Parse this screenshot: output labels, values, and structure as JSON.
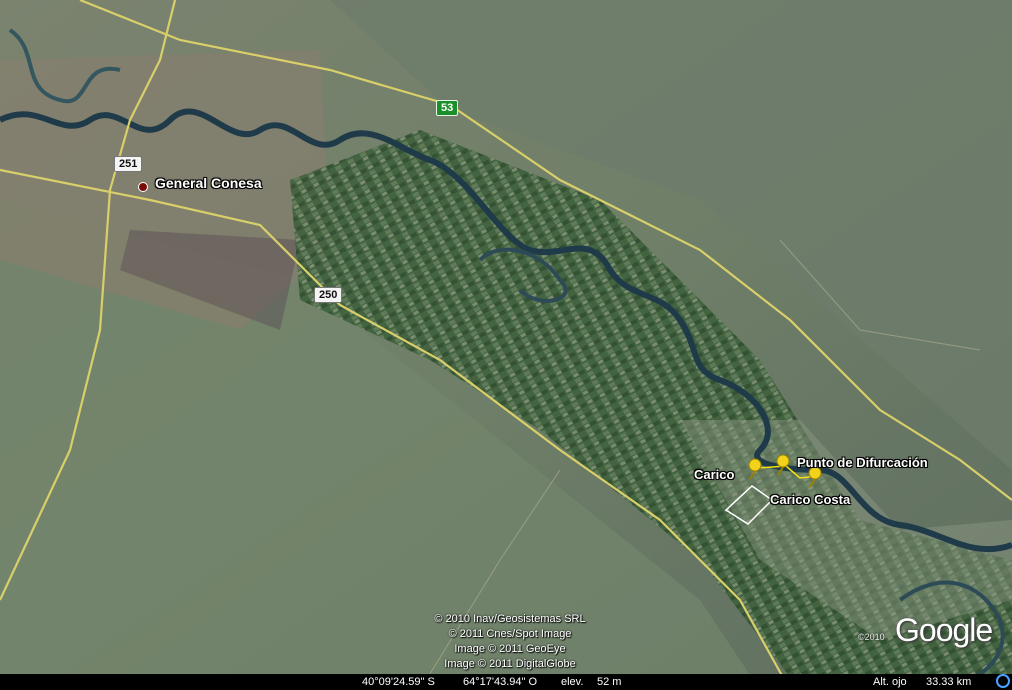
{
  "places": {
    "town": "General Conesa",
    "pin_carico": "Carico",
    "pin_carico_costa": "Carico Costa",
    "pin_difurcacion": "Punto de Difurcación"
  },
  "routes": {
    "r251": "251",
    "r250": "250",
    "r53": "53"
  },
  "copyright": [
    "© 2010 Inav/Geosistemas SRL",
    "© 2011 Cnes/Spot Image",
    "Image © 2011 GeoEye",
    "Image © 2011 DigitalGlobe"
  ],
  "logo": {
    "text": "Google",
    "year": "©2010"
  },
  "status_bar": {
    "lat": "40°09'24.59\" S",
    "lon": "64°17'43.94\" O",
    "elev_label": "elev.",
    "elev_value": "52 m",
    "alt_label": "Alt. ojo",
    "alt_value": "33.33 km"
  },
  "colors": {
    "river": "#1f3b4a",
    "road": "#d9cf6a",
    "pin": "#f2d21a",
    "fields": "#2f5a2e"
  }
}
